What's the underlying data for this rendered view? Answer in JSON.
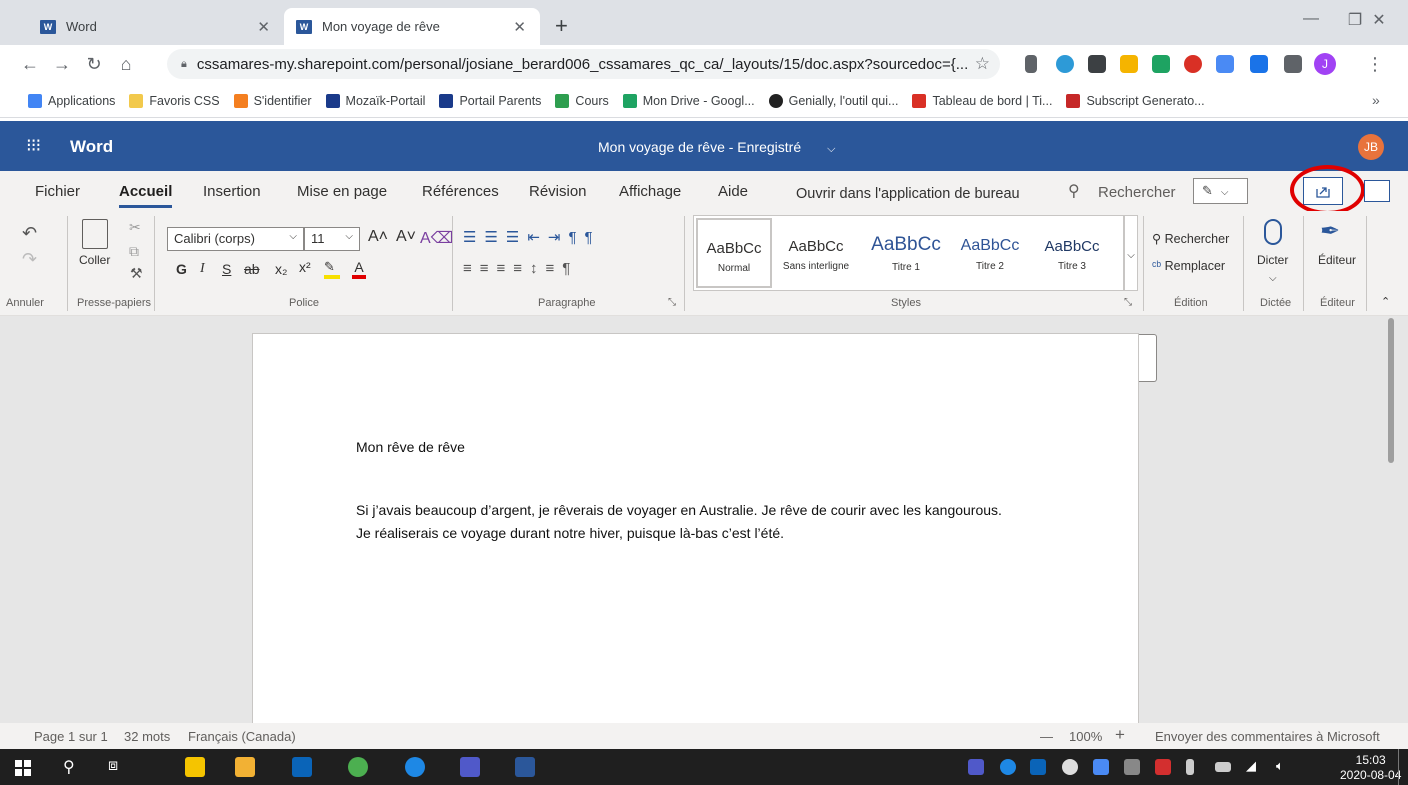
{
  "browser": {
    "tabs": [
      {
        "label": "Word",
        "icon": "word-icon"
      },
      {
        "label": "Mon voyage de rêve",
        "icon": "word-icon"
      }
    ],
    "new_tab_symbol": "+",
    "url": "cssamares-my.sharepoint.com/personal/josiane_berard006_cssamares_qc_ca/_layouts/15/doc.aspx?sourcedoc={...",
    "profile_initial": "J",
    "bookmarks": [
      "Applications",
      "Favoris CSS",
      "S'identifier",
      "Mozaïk-Portail",
      "Portail Parents",
      "Cours",
      "Mon Drive - Googl...",
      "Genially, l'outil qui...",
      "Tableau de bord | Ti...",
      "Subscript Generato..."
    ],
    "bookmarks_more": "»"
  },
  "word": {
    "app_name": "Word",
    "doc_title": "Mon voyage de rêve  -  Enregistré",
    "user_initials": "JB",
    "brand_color": "#2b579a",
    "ribbon_tabs": [
      "Fichier",
      "Accueil",
      "Insertion",
      "Mise en page",
      "Références",
      "Révision",
      "Affichage",
      "Aide"
    ],
    "open_desktop": "Ouvrir dans l'application de bureau",
    "search_label": "Rechercher",
    "ribbon": {
      "coller": "Coller",
      "font_name": "Calibri (corps)",
      "font_size": "11",
      "bold": "G",
      "italic": "I",
      "underline": "S",
      "strike": "ab",
      "styles": [
        {
          "preview": "AaBbCc",
          "name": "Normal"
        },
        {
          "preview": "AaBbCc",
          "name": "Sans interligne"
        },
        {
          "preview": "AaBbCc",
          "name": "Titre 1"
        },
        {
          "preview": "AaBbCc",
          "name": "Titre 2"
        },
        {
          "preview": "AaBbCc",
          "name": "Titre 3"
        }
      ],
      "rechercher": "Rechercher",
      "remplacer": "Remplacer",
      "dicter": "Dicter",
      "editeur": "Éditeur",
      "groups": [
        "Annuler",
        "Presse-papiers",
        "Police",
        "Paragraphe",
        "Styles",
        "Édition",
        "Dictée",
        "Éditeur"
      ]
    },
    "document": {
      "title_line": "Mon rêve de rêve",
      "line1": "Si j’avais beaucoup d’argent, je rêverais de voyager en Australie.  Je rêve de courir avec les kangourous.",
      "line2": "Je réaliserais ce voyage durant notre hiver, puisque là-bas c’est l’été."
    },
    "status": {
      "page": "Page 1 sur 1",
      "words": "32 mots",
      "language": "Français (Canada)",
      "zoom_minus": "—",
      "zoom": "100%",
      "zoom_plus": "+",
      "feedback": "Envoyer des commentaires à Microsoft"
    },
    "annotation_color": "#e00000"
  },
  "taskbar": {
    "time": "15:03",
    "date": "2020-08-04"
  }
}
